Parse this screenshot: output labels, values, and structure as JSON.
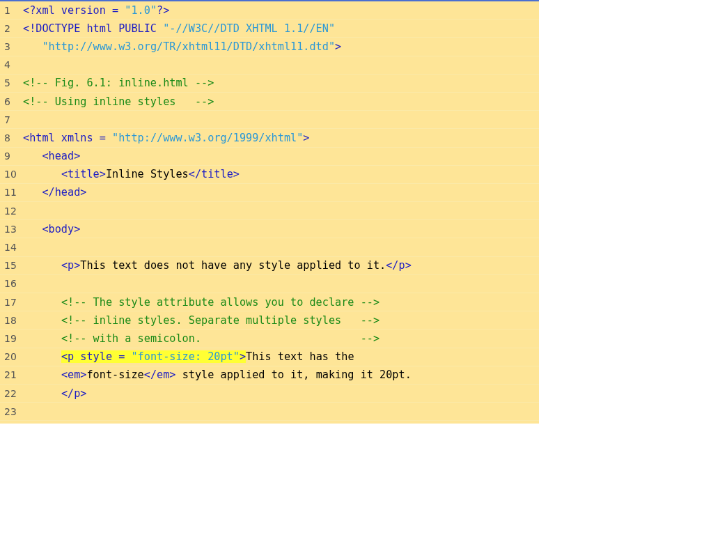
{
  "lines": [
    {
      "number": "1",
      "segments": [
        {
          "kind": "tag",
          "text": "<?xml version = "
        },
        {
          "kind": "string",
          "text": "\"1.0\""
        },
        {
          "kind": "tag",
          "text": "?>"
        }
      ]
    },
    {
      "number": "2",
      "segments": [
        {
          "kind": "tag",
          "text": "<!DOCTYPE html PUBLIC "
        },
        {
          "kind": "string",
          "text": "\"-//W3C//DTD XHTML 1.1//EN\""
        }
      ]
    },
    {
      "number": "3",
      "segments": [
        {
          "kind": "string",
          "text": "   \"http://www.w3.org/TR/xhtml11/DTD/xhtml11.dtd\""
        },
        {
          "kind": "tag",
          "text": ">"
        }
      ]
    },
    {
      "number": "4"
    },
    {
      "number": "5",
      "segments": [
        {
          "kind": "comment",
          "text": "<!-- Fig. 6.1: inline.html -->"
        }
      ]
    },
    {
      "number": "6",
      "segments": [
        {
          "kind": "comment",
          "text": "<!-- Using inline styles   -->"
        }
      ]
    },
    {
      "number": "7"
    },
    {
      "number": "8",
      "segments": [
        {
          "kind": "tag",
          "text": "<html xmlns = "
        },
        {
          "kind": "string",
          "text": "\"http://www.w3.org/1999/xhtml\""
        },
        {
          "kind": "tag",
          "text": ">"
        }
      ]
    },
    {
      "number": "9",
      "segments": [
        {
          "kind": "tag",
          "text": "   <head>"
        }
      ]
    },
    {
      "number": "10",
      "segments": [
        {
          "kind": "tag",
          "text": "      <title>"
        },
        {
          "kind": "text",
          "text": "Inline Styles"
        },
        {
          "kind": "tag",
          "text": "</title>"
        }
      ]
    },
    {
      "number": "11",
      "segments": [
        {
          "kind": "tag",
          "text": "   </head>"
        }
      ]
    },
    {
      "number": "12"
    },
    {
      "number": "13",
      "segments": [
        {
          "kind": "tag",
          "text": "   <body>"
        }
      ]
    },
    {
      "number": "14"
    },
    {
      "number": "15",
      "segments": [
        {
          "kind": "tag",
          "text": "      <p>"
        },
        {
          "kind": "text",
          "text": "This text does not have any style applied to it."
        },
        {
          "kind": "tag",
          "text": "</p>"
        }
      ]
    },
    {
      "number": "16"
    },
    {
      "number": "17",
      "segments": [
        {
          "kind": "comment",
          "text": "      <!-- The style attribute allows you to declare -->"
        }
      ]
    },
    {
      "number": "18",
      "segments": [
        {
          "kind": "comment",
          "text": "      <!-- inline styles. Separate multiple styles   -->"
        }
      ]
    },
    {
      "number": "19",
      "segments": [
        {
          "kind": "comment",
          "text": "      <!-- with a semicolon.                         -->"
        }
      ]
    },
    {
      "number": "20",
      "segments": [
        {
          "kind": "tag",
          "text": "      <p style = ",
          "highlighted": true
        },
        {
          "kind": "string",
          "text": "\"font-size: 20pt\"",
          "highlighted": true
        },
        {
          "kind": "tag",
          "text": ">",
          "highlighted": true
        },
        {
          "kind": "text",
          "text": "This text has the"
        }
      ]
    },
    {
      "number": "21",
      "segments": [
        {
          "kind": "tag",
          "text": "      <em>"
        },
        {
          "kind": "text",
          "text": "font-size"
        },
        {
          "kind": "tag",
          "text": "</em>"
        },
        {
          "kind": "text",
          "text": " style applied to it, making it 20pt."
        }
      ]
    },
    {
      "number": "22",
      "segments": [
        {
          "kind": "tag",
          "text": "      </p>"
        }
      ]
    },
    {
      "number": "23"
    }
  ]
}
